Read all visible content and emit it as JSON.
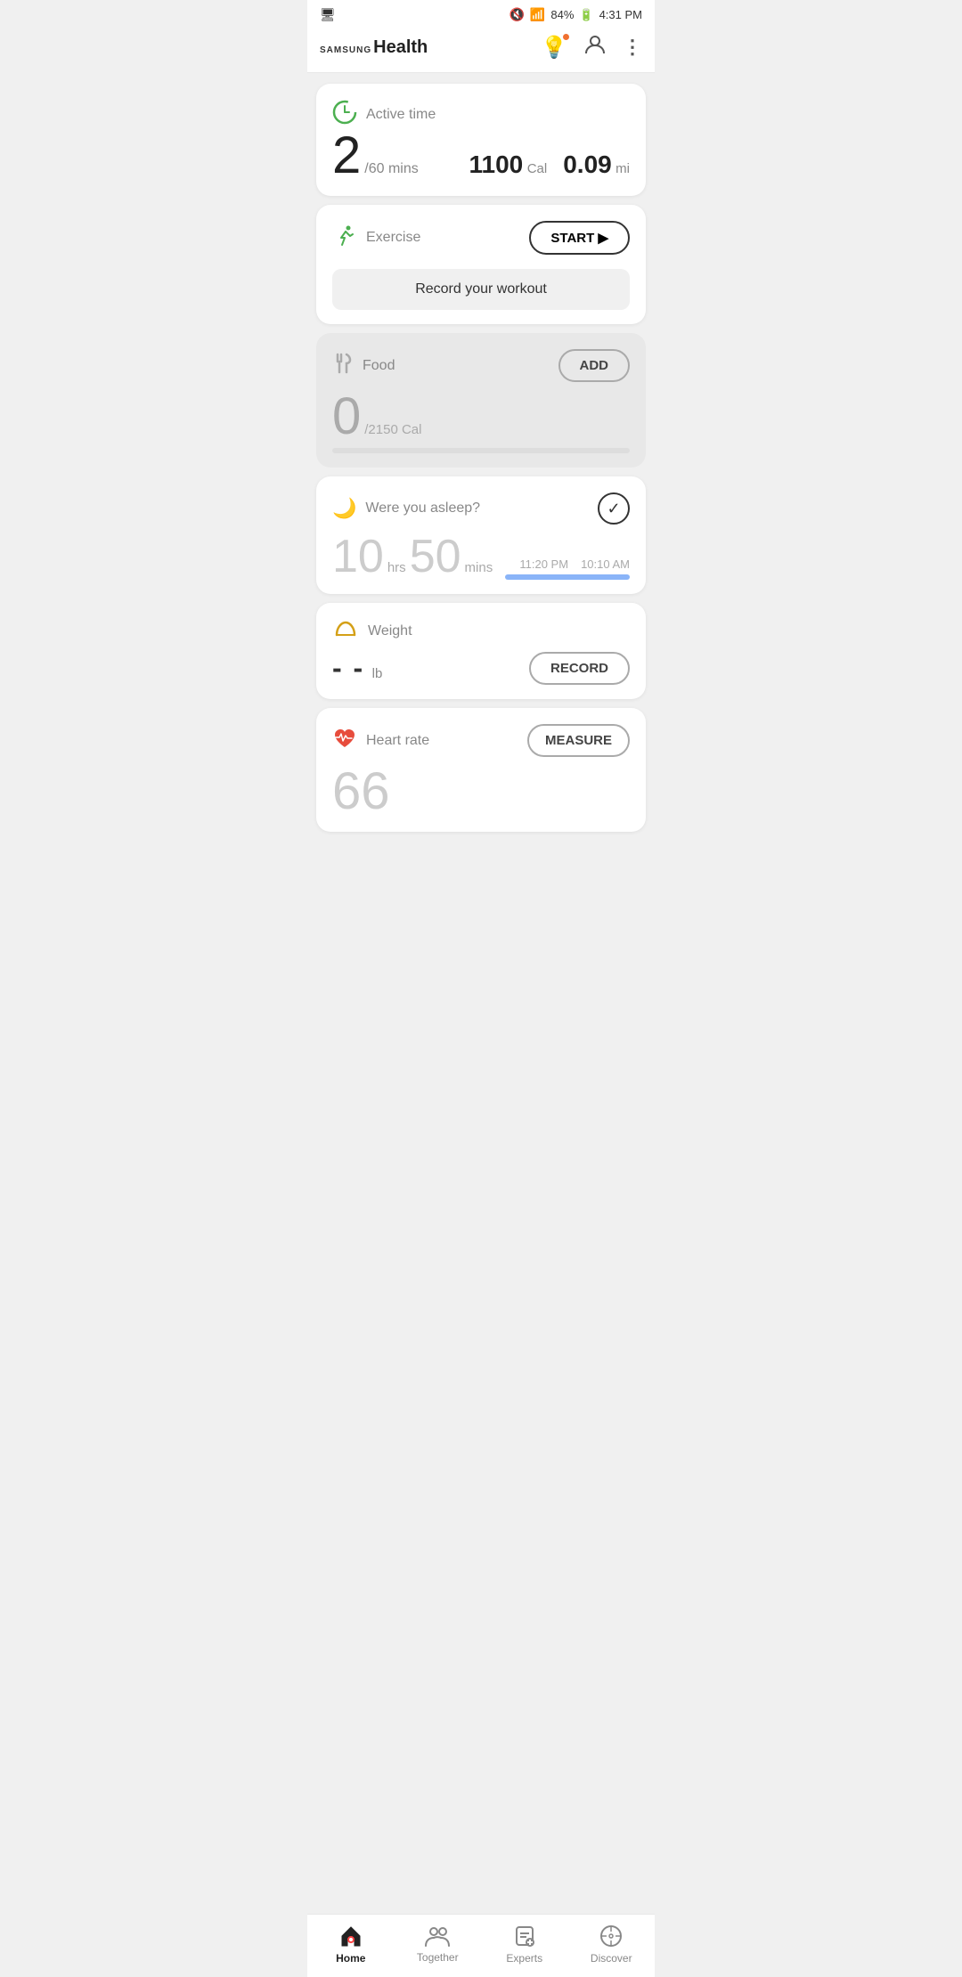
{
  "statusBar": {
    "left": "☰",
    "battery": "84%",
    "time": "4:31 PM",
    "signal": "📶"
  },
  "appBar": {
    "logoSamsung": "SAMSUNG",
    "logoHealth": "Health",
    "icons": {
      "bulb": "💡",
      "profile": "👤",
      "menu": "⋮"
    },
    "hasNotification": true
  },
  "cards": {
    "activeTime": {
      "title": "Active time",
      "value": "2",
      "goal": "/60 mins",
      "calories": "1100",
      "caloriesUnit": "Cal",
      "distance": "0.09",
      "distanceUnit": "mi"
    },
    "exercise": {
      "title": "Exercise",
      "startLabel": "START ▶",
      "recordLabel": "Record your workout"
    },
    "food": {
      "title": "Food",
      "addLabel": "ADD",
      "value": "0",
      "goal": "/2150 Cal"
    },
    "sleep": {
      "title": "Were you asleep?",
      "hours": "10",
      "hoursUnit": "hrs",
      "minutes": "50",
      "minutesUnit": "mins",
      "startTime": "11:20 PM",
      "endTime": "10:10 AM"
    },
    "weight": {
      "title": "Weight",
      "valueDashes": "- -",
      "unit": "lb",
      "recordLabel": "RECORD"
    },
    "heartRate": {
      "title": "Heart rate",
      "value": "66",
      "measureLabel": "MEASURE"
    }
  },
  "bottomNav": {
    "items": [
      {
        "id": "home",
        "label": "Home",
        "active": true
      },
      {
        "id": "together",
        "label": "Together",
        "active": false
      },
      {
        "id": "experts",
        "label": "Experts",
        "active": false
      },
      {
        "id": "discover",
        "label": "Discover",
        "active": false
      }
    ]
  }
}
